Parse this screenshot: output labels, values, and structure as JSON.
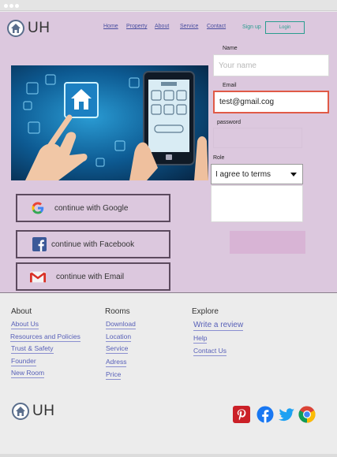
{
  "brand": {
    "logo_text": "UH"
  },
  "nav": {
    "links": [
      "Home",
      "Property",
      "About",
      "Service",
      "Contact"
    ],
    "signup": "Sign up",
    "login": "Login"
  },
  "form": {
    "name_label": "Name",
    "name_placeholder": "Your name",
    "email_label": "Email",
    "email_value": "test@gmail.cog",
    "password_label": "password",
    "role_label": "Role",
    "role_selected": "I agree to terms"
  },
  "social_buttons": {
    "google": "continue with Google",
    "facebook": "continue with Facebook",
    "email": "continue with Email"
  },
  "footer": {
    "about": {
      "heading": "About",
      "links": [
        "About Us",
        "Resources and Policies",
        "Trust & Safety",
        "Founder",
        "New Room"
      ]
    },
    "rooms": {
      "heading": "Rooms",
      "links": [
        "Download",
        "Location",
        "Service",
        "Adress",
        "Price"
      ]
    },
    "explore": {
      "heading": "Explore",
      "links": [
        "Write a review",
        "Help",
        "Contact Us"
      ]
    },
    "logo_text": "UH",
    "social_icons": [
      "pinterest-icon",
      "facebook-icon",
      "twitter-icon",
      "chrome-icon"
    ]
  },
  "colors": {
    "hero_bg": "#dcc8de",
    "accent": "#2a9d8f",
    "link": "#5860b8",
    "error": "#e05a47"
  }
}
